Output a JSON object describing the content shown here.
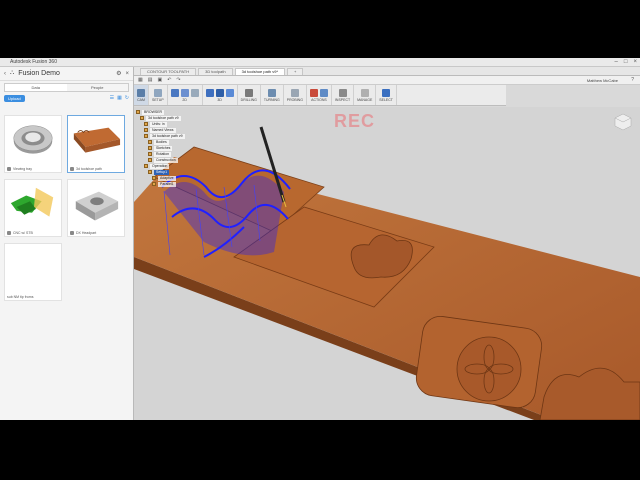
{
  "window": {
    "title": "Autodesk Fusion 360"
  },
  "panel": {
    "project": "Fusion Demo",
    "tabs": [
      "Data",
      "People"
    ],
    "upload_label": "Upload",
    "items": [
      {
        "caption": "Viewing tray"
      },
      {
        "caption": "3d toolshoe path"
      },
      {
        "caption": "CNC w/ STB"
      },
      {
        "caption": "DX Headpart"
      },
      {
        "caption": "sub NM tip froms"
      }
    ]
  },
  "doc_tabs": [
    {
      "label": "CONTOUR TOOLPATH"
    },
    {
      "label": "3D toolpath"
    },
    {
      "label": "3d toolshoe path v9*"
    }
  ],
  "user": "Matthew McCabe",
  "ribbon": {
    "workspace": "CAM",
    "groups": [
      "SETUP",
      "2D",
      "3D",
      "DRILLING",
      "TURNING",
      "PROBING",
      "ACTIONS",
      "INSPECT",
      "MANAGE",
      "SELECT"
    ]
  },
  "browser": {
    "nodes": [
      {
        "label": "BROWSER",
        "depth": 0
      },
      {
        "label": "3d toolshoe path v9",
        "depth": 1
      },
      {
        "label": "Units: in",
        "depth": 2
      },
      {
        "label": "Named Views",
        "depth": 2
      },
      {
        "label": "3d toolshoe path v9",
        "depth": 2
      },
      {
        "label": "Bodies",
        "depth": 3
      },
      {
        "label": "Sketches",
        "depth": 3
      },
      {
        "label": "Rotation",
        "depth": 3
      },
      {
        "label": "Construction",
        "depth": 3
      },
      {
        "label": "Operation",
        "depth": 2
      },
      {
        "label": "Setup1",
        "depth": 3
      },
      {
        "label": "Adaptive",
        "depth": 4
      },
      {
        "label": "Parallel1",
        "depth": 4
      }
    ],
    "selected": "Setup1"
  },
  "colors": {
    "model": "#b5652f",
    "toolpath": "#1a1aff",
    "bg": "#d4d4d4"
  },
  "watermark": "REC"
}
